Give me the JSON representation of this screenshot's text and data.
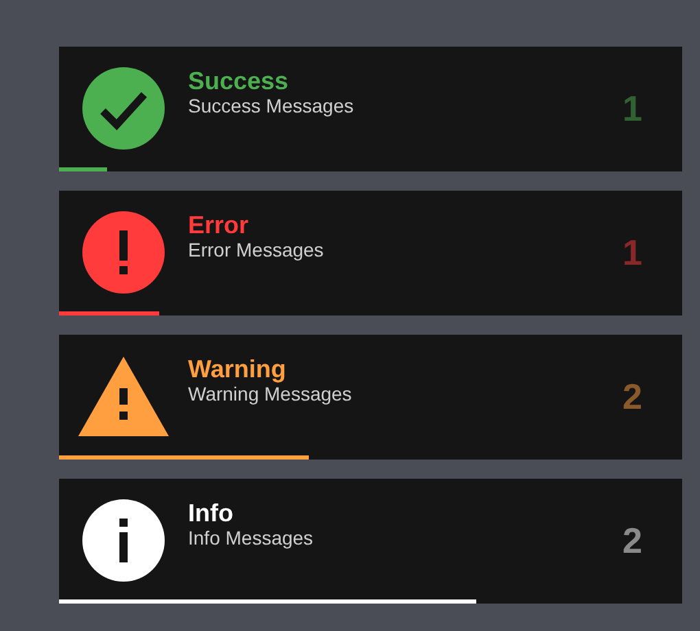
{
  "notifications": [
    {
      "kind": "success",
      "title": "Success",
      "subtitle": "Success Messages",
      "count": "1",
      "color": "#4caf50",
      "level": 0.077
    },
    {
      "kind": "error",
      "title": "Error",
      "subtitle": "Error Messages",
      "count": "1",
      "color": "#ff3b3b",
      "level": 0.16
    },
    {
      "kind": "warning",
      "title": "Warning",
      "subtitle": "Warning Messages",
      "count": "2",
      "color": "#ff9f3f",
      "level": 0.4
    },
    {
      "kind": "info",
      "title": "Info",
      "subtitle": "Info Messages",
      "count": "2",
      "color": "#ffffff",
      "level": 0.67
    }
  ]
}
